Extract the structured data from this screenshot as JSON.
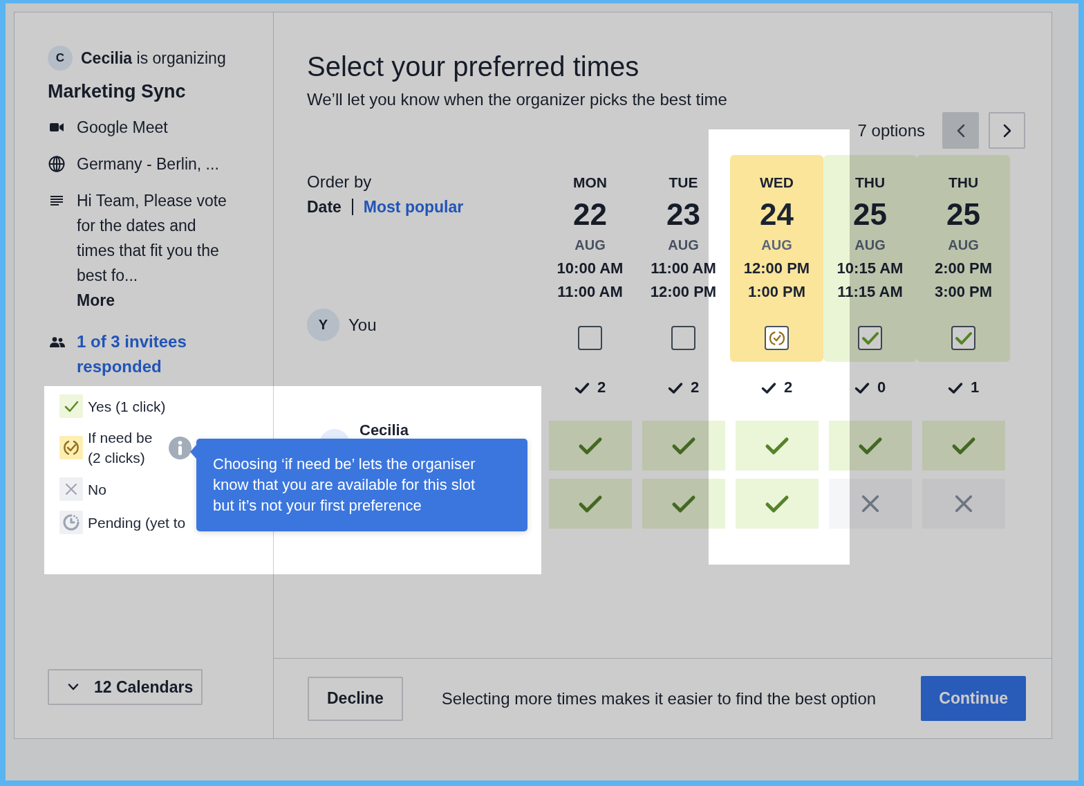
{
  "organizer": {
    "initial": "C",
    "text": "**Cecilia** is organizing"
  },
  "event": {
    "title": "Marketing Sync",
    "details": [
      {
        "kind": "video",
        "text": "Google Meet"
      },
      {
        "kind": "location",
        "text": "Germany - Berlin, ..."
      },
      {
        "kind": "description",
        "lines": [
          "Hi Team, Please vote",
          "for the dates and",
          "times that fit you the",
          "best fo..."
        ],
        "more": "More"
      }
    ],
    "invitees_link": "1 of 3 invitees responded"
  },
  "legend": [
    {
      "kind": "yes",
      "label": "Yes (1 click)",
      "info": false
    },
    {
      "kind": "if_need_be",
      "label": "If need be (2 clicks)",
      "info": true
    },
    {
      "kind": "no",
      "label": "No",
      "info": false
    },
    {
      "kind": "pending",
      "label": "Pending (yet to",
      "info": false
    }
  ],
  "calendars": {
    "label": "12 Calendars",
    "expanded": false
  },
  "header": {
    "title": "Select your preferred times",
    "subtitle": "We’ll let you know when the organizer picks the best time"
  },
  "pager": {
    "label": "7 options",
    "prev_disabled": true,
    "next_disabled": false
  },
  "order_by": {
    "label": "Order by",
    "options": [
      {
        "label": "Date",
        "selected": true
      },
      {
        "label": "Most popular",
        "selected": false
      }
    ]
  },
  "you": {
    "initial": "Y",
    "name": "You"
  },
  "slots": [
    {
      "weekday": "MON",
      "day": "22",
      "month": "AUG",
      "start": "10:00 AM",
      "end": "11:00 AM",
      "checked": false,
      "if_need_be": false,
      "count": "2"
    },
    {
      "weekday": "TUE",
      "day": "23",
      "month": "AUG",
      "start": "11:00 AM",
      "end": "12:00 PM",
      "checked": false,
      "if_need_be": false,
      "count": "2"
    },
    {
      "weekday": "WED",
      "day": "24",
      "month": "AUG",
      "start": "12:00 PM",
      "end": "1:00 PM",
      "checked": true,
      "if_need_be": true,
      "count": "2"
    },
    {
      "weekday": "THU",
      "day": "25",
      "month": "AUG",
      "start": "10:15 AM",
      "end": "11:15 AM",
      "checked": true,
      "if_need_be": false,
      "count": "0"
    },
    {
      "weekday": "THU",
      "day": "25",
      "month": "AUG",
      "start": "2:00 PM",
      "end": "3:00 PM",
      "checked": true,
      "if_need_be": false,
      "count": "1"
    }
  ],
  "participants": [
    {
      "name": "Cecilia",
      "votes": [
        {
          "kind": "yes"
        },
        {
          "kind": "yes"
        },
        {
          "kind": "yes"
        },
        {
          "kind": "yes"
        },
        {
          "kind": "yes"
        }
      ]
    },
    {
      "votes": [
        {
          "kind": "yes"
        },
        {
          "kind": "yes"
        },
        {
          "kind": "yes"
        },
        {
          "kind": "no"
        },
        {
          "kind": "no"
        }
      ]
    }
  ],
  "tooltip": "Choosing ‘if need be’ lets the organiser know that you are available for this slot but it’s not your first preference",
  "footer": {
    "decline": "Decline",
    "hint": "Selecting more times makes it easier to find the best option",
    "continue": "Continue"
  }
}
